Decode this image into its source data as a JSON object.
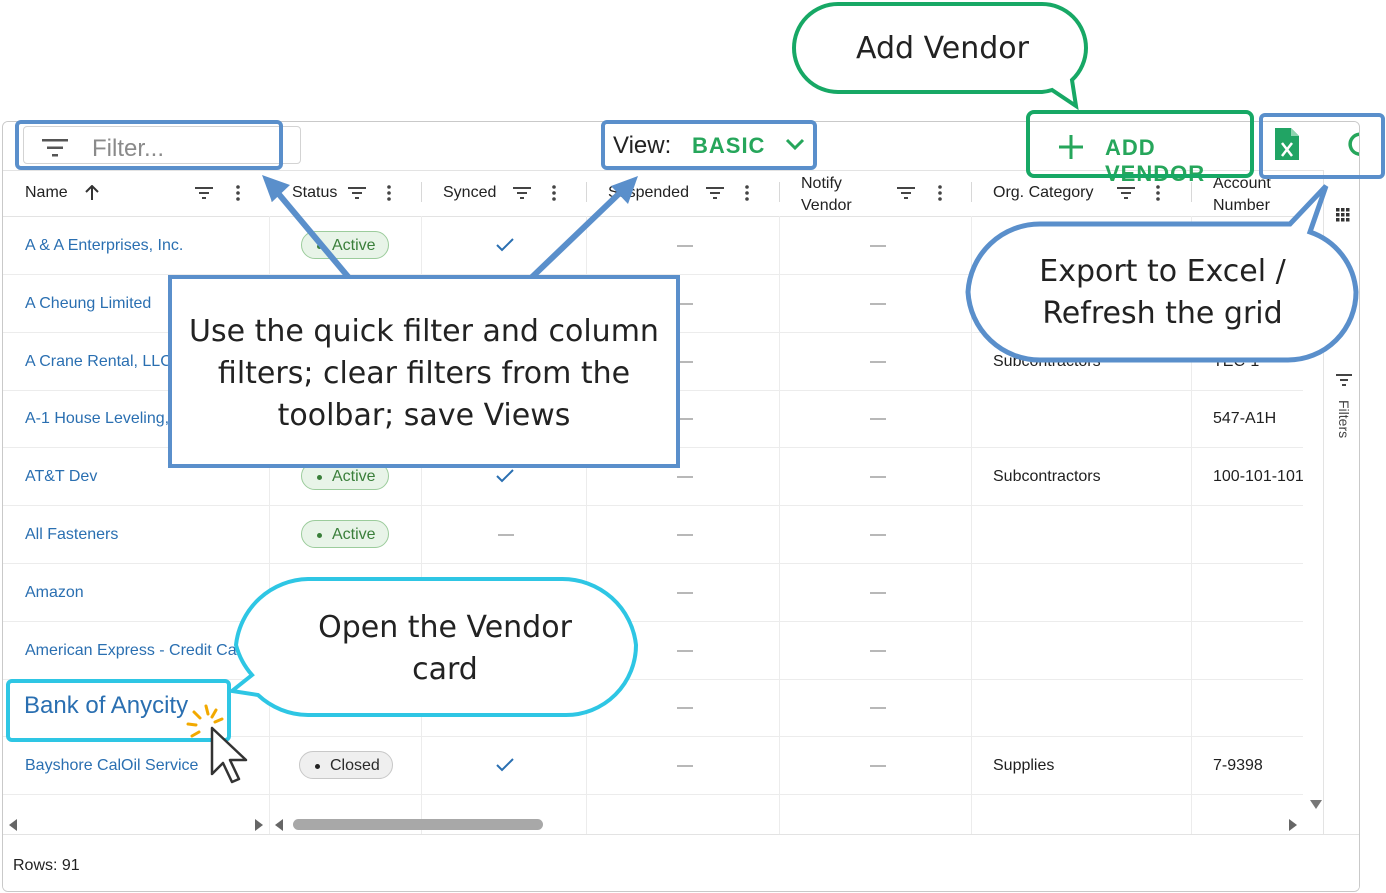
{
  "toolbar": {
    "filter_placeholder": "Filter...",
    "view_label": "View:",
    "view_value": "BASIC",
    "add_vendor_label": "ADD VENDOR"
  },
  "columns": {
    "name": "Name",
    "status": "Status",
    "synced": "Synced",
    "suspended": "Suspended",
    "notify_line1": "Notify",
    "notify_line2": "Vendor",
    "org_category": "Org. Category",
    "account_line1": "Account",
    "account_line2": "Number"
  },
  "rows": [
    {
      "name": "A & A Enterprises, Inc.",
      "status": "Active",
      "synced": true,
      "org": "",
      "acct": ""
    },
    {
      "name": "A Cheung Limited",
      "status": "",
      "synced": false,
      "org": "",
      "acct": ""
    },
    {
      "name": "A Crane Rental, LLC",
      "status": "",
      "synced": false,
      "org": "Subcontractors",
      "acct": "TEC-1"
    },
    {
      "name": "A-1 House Leveling,",
      "status": "",
      "synced": false,
      "org": "",
      "acct": "547-A1H"
    },
    {
      "name": "AT&T Dev",
      "status": "Active",
      "synced": true,
      "org": "Subcontractors",
      "acct": "100-101-101"
    },
    {
      "name": "All Fasteners",
      "status": "Active",
      "synced": false,
      "org": "",
      "acct": ""
    },
    {
      "name": "Amazon",
      "status": "",
      "synced": false,
      "org": "",
      "acct": ""
    },
    {
      "name": "American Express - Credit Card",
      "status": "",
      "synced": false,
      "org": "",
      "acct": ""
    },
    {
      "name": "",
      "status": "",
      "synced": false,
      "org": "",
      "acct": ""
    },
    {
      "name": "Bayshore CalOil Service",
      "status": "Closed",
      "synced": true,
      "org": "Supplies",
      "acct": "7-9398"
    }
  ],
  "sidebar": {
    "filters_label": "Filters"
  },
  "footer": {
    "rows_label": "Rows: 91"
  },
  "annotations": {
    "add_vendor_bubble": "Add Vendor",
    "export_bubble_line1": "Export to Excel /",
    "export_bubble_line2": "Refresh the grid",
    "filter_callout_line1": "Use the quick filter and column",
    "filter_callout_line2": "filters; clear filters from the",
    "filter_callout_line3": "toolbar; save Views",
    "vendor_card_line1": "Open the Vendor",
    "vendor_card_line2": "card",
    "bank_link": "Bank of Anycity"
  },
  "colors": {
    "accent_green": "#26a65b",
    "link_blue": "#2a6fb1",
    "callout_blue": "#5a8fcb",
    "callout_cyan": "#2ec6e4",
    "bubble_green": "#17a865"
  }
}
